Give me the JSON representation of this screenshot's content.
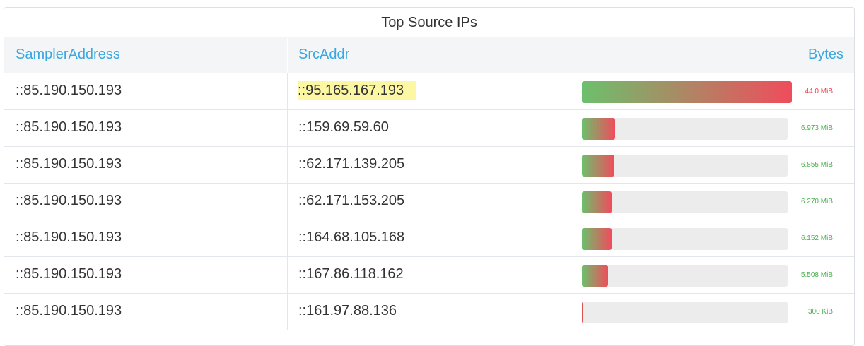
{
  "panel": {
    "title": "Top Source IPs"
  },
  "columns": {
    "sampler": "SamplerAddress",
    "src": "SrcAddr",
    "bytes": "Bytes"
  },
  "rows": [
    {
      "sampler": "::85.190.150.193",
      "src": "::95.165.167.193",
      "bytes": "44.0 MiB",
      "fraction": 1.0,
      "highlighted": true
    },
    {
      "sampler": "::85.190.150.193",
      "src": "::159.69.59.60",
      "bytes": "6.973 MiB",
      "fraction": 0.158
    },
    {
      "sampler": "::85.190.150.193",
      "src": "::62.171.139.205",
      "bytes": "6.855 MiB",
      "fraction": 0.156
    },
    {
      "sampler": "::85.190.150.193",
      "src": "::62.171.153.205",
      "bytes": "6.270 MiB",
      "fraction": 0.143
    },
    {
      "sampler": "::85.190.150.193",
      "src": "::164.68.105.168",
      "bytes": "6.152 MiB",
      "fraction": 0.14
    },
    {
      "sampler": "::85.190.150.193",
      "src": "::167.86.118.162",
      "bytes": "5.508 MiB",
      "fraction": 0.125
    },
    {
      "sampler": "::85.190.150.193",
      "src": "::161.97.88.136",
      "bytes": "300 KiB",
      "fraction": 0.007
    }
  ],
  "colors": {
    "header_text": "#3aa7e0",
    "bar_start": "#6cc06c",
    "bar_end": "#f04c5c",
    "highlight": "#fbf7a3"
  }
}
